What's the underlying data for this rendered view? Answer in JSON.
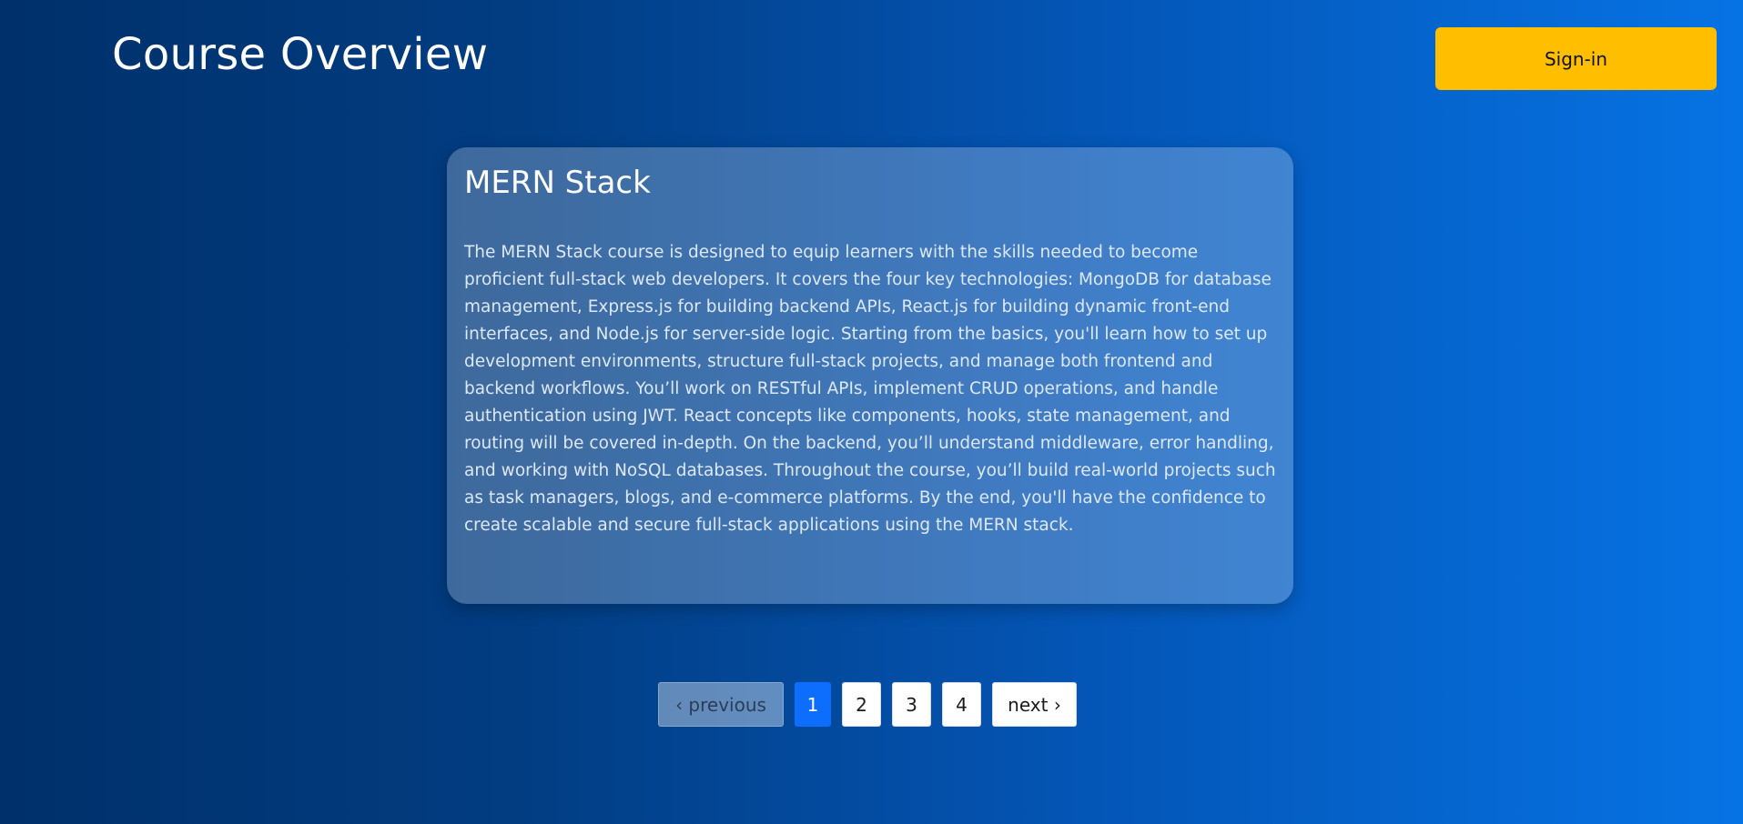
{
  "header": {
    "title": "Course Overview",
    "signin_label": "Sign-in"
  },
  "course": {
    "title": "MERN Stack",
    "description": "The MERN Stack course is designed to equip learners with the skills needed to become proficient full-stack web developers. It covers the four key technologies: MongoDB for database management, Express.js for building backend APIs, React.js for building dynamic front-end interfaces, and Node.js for server-side logic. Starting from the basics, you'll learn how to set up development environments, structure full-stack projects, and manage both frontend and backend workflows. You’ll work on RESTful APIs, implement CRUD operations, and handle authentication using JWT. React concepts like components, hooks, state management, and routing will be covered in-depth. On the backend, you’ll understand middleware, error handling, and working with NoSQL databases. Throughout the course, you’ll build real-world projects such as task managers, blogs, and e-commerce platforms. By the end, you'll have the confidence to create scalable and secure full-stack applications using the MERN stack."
  },
  "pagination": {
    "previous_label": "‹ previous",
    "pages": [
      "1",
      "2",
      "3",
      "4"
    ],
    "current_page": "1",
    "next_label": "next ›"
  },
  "colors": {
    "accent_button": "#ffbf00",
    "active_page": "#0d6efd",
    "background_start": "#00306a",
    "background_end": "#0673e4"
  }
}
